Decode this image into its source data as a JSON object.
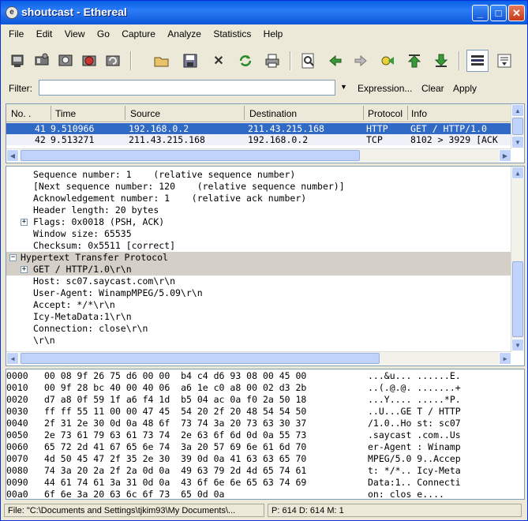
{
  "window": {
    "title": "shoutcast - Ethereal"
  },
  "menu": [
    "File",
    "Edit",
    "View",
    "Go",
    "Capture",
    "Analyze",
    "Statistics",
    "Help"
  ],
  "toolbar": {
    "icons": [
      "interfaces-icon",
      "capture-options-icon",
      "start-capture-icon",
      "stop-capture-icon",
      "restart-capture-icon",
      "open-file-icon",
      "save-file-icon",
      "close-file-icon",
      "reload-icon",
      "print-icon",
      "find-packet-icon",
      "go-back-icon",
      "go-forward-icon",
      "go-to-packet-icon",
      "go-first-icon",
      "go-last-icon",
      "colorize-icon",
      "auto-scroll-icon"
    ]
  },
  "filter": {
    "label": "Filter:",
    "value": "",
    "expression_label": "Expression...",
    "clear_label": "Clear",
    "apply_label": "Apply"
  },
  "packet_list": {
    "columns": [
      "No. .",
      "Time",
      "Source",
      "Destination",
      "Protocol",
      "Info"
    ],
    "rows": [
      {
        "no": "41",
        "time": "9.510966",
        "source": "192.168.0.2",
        "destination": "211.43.215.168",
        "protocol": "HTTP",
        "info": "GET / HTTP/1.0",
        "selected": true
      },
      {
        "no": "42",
        "time": "9.513271",
        "source": "211.43.215.168",
        "destination": "192.168.0.2",
        "protocol": "TCP",
        "info": "8102 > 3929 [ACK",
        "selected": false
      }
    ]
  },
  "details": [
    {
      "text": "Sequence number: 1    (relative sequence number)",
      "indent": 1,
      "expander": "",
      "highlight": false
    },
    {
      "text": "[Next sequence number: 120    (relative sequence number)]",
      "indent": 1,
      "expander": "",
      "highlight": false
    },
    {
      "text": "Acknowledgement number: 1    (relative ack number)",
      "indent": 1,
      "expander": "",
      "highlight": false
    },
    {
      "text": "Header length: 20 bytes",
      "indent": 1,
      "expander": "",
      "highlight": false
    },
    {
      "text": "Flags: 0x0018 (PSH, ACK)",
      "indent": 1,
      "expander": "+",
      "highlight": false
    },
    {
      "text": "Window size: 65535",
      "indent": 1,
      "expander": "",
      "highlight": false
    },
    {
      "text": "Checksum: 0x5511 [correct]",
      "indent": 1,
      "expander": "",
      "highlight": false
    },
    {
      "text": "Hypertext Transfer Protocol",
      "indent": 0,
      "expander": "−",
      "highlight": true
    },
    {
      "text": "GET / HTTP/1.0\\r\\n",
      "indent": 1,
      "expander": "+",
      "highlight": true
    },
    {
      "text": "Host: sc07.saycast.com\\r\\n",
      "indent": 1,
      "expander": "",
      "highlight": false
    },
    {
      "text": "User-Agent: WinampMPEG/5.09\\r\\n",
      "indent": 1,
      "expander": "",
      "highlight": false
    },
    {
      "text": "Accept: */*\\r\\n",
      "indent": 1,
      "expander": "",
      "highlight": false
    },
    {
      "text": "Icy-MetaData:1\\r\\n",
      "indent": 1,
      "expander": "",
      "highlight": false
    },
    {
      "text": "Connection: close\\r\\n",
      "indent": 1,
      "expander": "",
      "highlight": false
    },
    {
      "text": "\\r\\n",
      "indent": 1,
      "expander": "",
      "highlight": false
    }
  ],
  "hex": [
    {
      "offset": "0000",
      "bytes": "00 08 9f 26 75 d6 00 00  b4 c4 d6 93 08 00 45 00",
      "ascii": "...&u... ......E."
    },
    {
      "offset": "0010",
      "bytes": "00 9f 28 bc 40 00 40 06  a6 1e c0 a8 00 02 d3 2b",
      "ascii": "..(.@.@. .......+"
    },
    {
      "offset": "0020",
      "bytes": "d7 a8 0f 59 1f a6 f4 1d  b5 04 ac 0a f0 2a 50 18",
      "ascii": "...Y.... .....*P."
    },
    {
      "offset": "0030",
      "bytes": "ff ff 55 11 00 00 47 45  54 20 2f 20 48 54 54 50",
      "ascii": "..U...GE T / HTTP"
    },
    {
      "offset": "0040",
      "bytes": "2f 31 2e 30 0d 0a 48 6f  73 74 3a 20 73 63 30 37",
      "ascii": "/1.0..Ho st: sc07"
    },
    {
      "offset": "0050",
      "bytes": "2e 73 61 79 63 61 73 74  2e 63 6f 6d 0d 0a 55 73",
      "ascii": ".saycast .com..Us"
    },
    {
      "offset": "0060",
      "bytes": "65 72 2d 41 67 65 6e 74  3a 20 57 69 6e 61 6d 70",
      "ascii": "er-Agent : Winamp"
    },
    {
      "offset": "0070",
      "bytes": "4d 50 45 47 2f 35 2e 30  39 0d 0a 41 63 63 65 70",
      "ascii": "MPEG/5.0 9..Accep"
    },
    {
      "offset": "0080",
      "bytes": "74 3a 20 2a 2f 2a 0d 0a  49 63 79 2d 4d 65 74 61",
      "ascii": "t: */*.. Icy-Meta"
    },
    {
      "offset": "0090",
      "bytes": "44 61 74 61 3a 31 0d 0a  43 6f 6e 6e 65 63 74 69",
      "ascii": "Data:1.. Connecti"
    },
    {
      "offset": "00a0",
      "bytes": "6f 6e 3a 20 63 6c 6f 73  65 0d 0a",
      "ascii": "on: clos e...."
    }
  ],
  "status": {
    "file": "File: \"C:\\Documents and Settings\\tjkim93\\My Documents\\...",
    "packets": "P: 614 D: 614 M: 1"
  },
  "colors": {
    "selection": "#316ac5",
    "highlight": "#d4d0c8",
    "titlebar": "#0a5fe8"
  }
}
